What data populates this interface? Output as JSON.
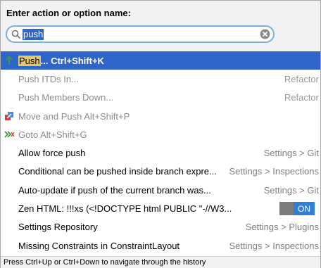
{
  "header": {
    "prompt": "Enter action or option name:",
    "search_value": "push",
    "search_icon": "search-icon",
    "clear_icon": "clear-icon"
  },
  "results": [
    {
      "label": "Push",
      "label_rest": "... Ctrl+Shift+K",
      "right": "",
      "state": "selected",
      "icon": "vcs-push-icon"
    },
    {
      "label": "Push ITDs In...",
      "right": "Refactor",
      "state": "disabled"
    },
    {
      "label": "Push Members Down...",
      "right": "Refactor",
      "state": "disabled"
    },
    {
      "label": "Move and Push Alt+Shift+P",
      "right": "",
      "state": "disabled",
      "icon": "move-push-icon"
    },
    {
      "label": "Goto Alt+Shift+G",
      "right": "",
      "state": "disabled",
      "icon": "goto-icon"
    },
    {
      "label": "Allow force push",
      "right": "Settings > Git",
      "state": "option"
    },
    {
      "label": "Conditional can be pushed inside branch expre...",
      "right": "Settings > Inspections",
      "state": "option"
    },
    {
      "label": "Auto-update if push of the current branch was...",
      "right": "Settings > Git",
      "state": "option"
    },
    {
      "label": "Zen HTML: !!!xs (<!DOCTYPE html PUBLIC \"-//W3...",
      "right": "",
      "state": "option",
      "toggle": "ON"
    },
    {
      "label": "Settings Repository",
      "right": "Settings > Plugins",
      "state": "option"
    },
    {
      "label": "Missing Constraints in ConstraintLayout",
      "right": "Settings > Inspections",
      "state": "option"
    }
  ],
  "footer": {
    "hint": "Press Ctrl+Up or Ctrl+Down to navigate through the history"
  },
  "colors": {
    "selection": "#2f65ca",
    "match_highlight": "#e6c86a",
    "toggle_on": "#2f7ed8"
  }
}
